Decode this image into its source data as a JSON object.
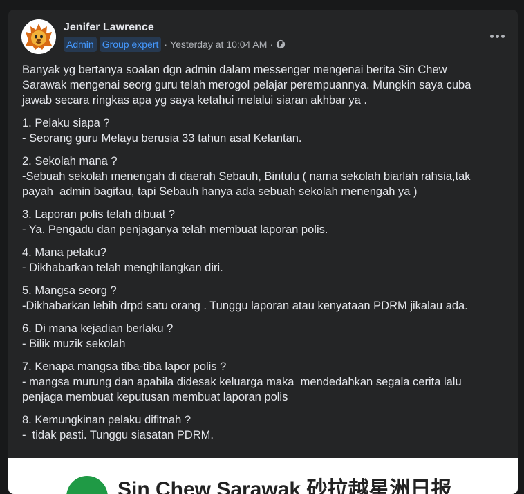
{
  "post": {
    "author": "Jenifer Lawrence",
    "badges": [
      "Admin",
      "Group expert"
    ],
    "separator": "·",
    "timestamp": "Yesterday at 10:04 AM",
    "separator2": "·",
    "privacy_icon": "globe-icon",
    "more_icon": "more-options-icon",
    "paragraphs": [
      [
        "Banyak yg bertanya soalan dgn admin dalam messenger mengenai berita Sin Chew",
        "Sarawak mengenai seorg guru telah merogol pelajar perempuannya. Mungkin saya cuba",
        "jawab secara ringkas apa yg saya ketahui melalui siaran akhbar ya ."
      ],
      [
        "1. Pelaku siapa ?",
        "- Seorang guru Melayu berusia 33 tahun asal Kelantan."
      ],
      [
        "2. Sekolah mana ?",
        "-Sebuah sekolah menengah di daerah Sebauh, Bintulu ( nama sekolah biarlah rahsia,tak",
        "payah  admin bagitau, tapi Sebauh hanya ada sebuah sekolah menengah ya )"
      ],
      [
        "3. Laporan polis telah dibuat ?",
        "- Ya. Pengadu dan penjaganya telah membuat laporan polis."
      ],
      [
        "4. Mana pelaku?",
        "- Dikhabarkan telah menghilangkan diri."
      ],
      [
        "5. Mangsa seorg ?",
        "-Dikhabarkan lebih drpd satu orang . Tunggu laporan atau kenyataan PDRM jikalau ada."
      ],
      [
        "6. Di mana kejadian berlaku ?",
        "- Bilik muzik sekolah"
      ],
      [
        "7. Kenapa mangsa tiba-tiba lapor polis ?",
        "- mangsa murung dan apabila didesak keluarga maka  mendedahkan segala cerita lalu",
        "penjaga membuat keputusan membuat laporan polis"
      ],
      [
        "8. Kemungkinan pelaku difitnah ?",
        "-  tidak pasti. Tunggu siasatan PDRM."
      ]
    ]
  },
  "link_preview": {
    "title": "Sin Chew Sarawak 砂拉越星洲日报"
  },
  "colors": {
    "background": "#18191a",
    "card": "#242526",
    "text": "#e4e6eb",
    "secondary_text": "#b0b3b8",
    "badge_bg": "#263951",
    "badge_text": "#4599ff"
  }
}
